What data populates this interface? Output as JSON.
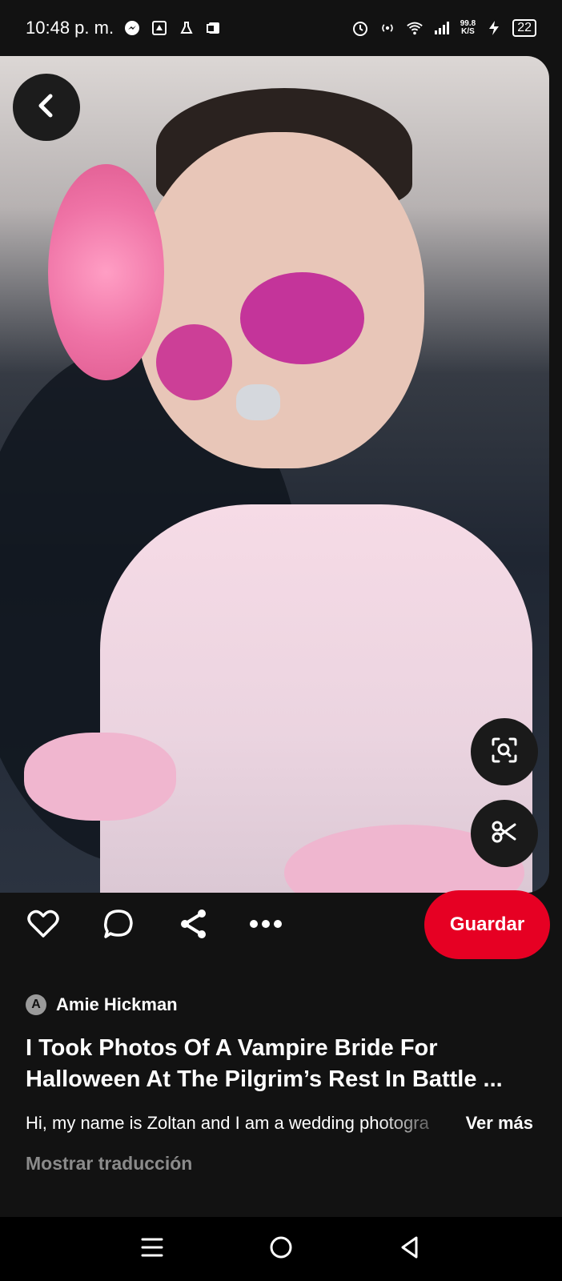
{
  "status_bar": {
    "time": "10:48 p. m.",
    "network_speed_value": "99.8",
    "network_speed_unit": "K/S",
    "battery": "22",
    "icons": [
      "messenger-icon",
      "news-icon",
      "lab-icon",
      "office-icon",
      "alarm-icon",
      "hotspot-icon",
      "wifi-icon",
      "signal-icon",
      "charging-icon",
      "battery-icon"
    ]
  },
  "pin": {
    "image_alt": "Child with sugar-skull face makeup, pink flower and pink dress",
    "author": {
      "initial": "A",
      "name": "Amie Hickman"
    },
    "title": "I Took Photos Of A Vampire Bride For Halloween At The Pilgrim’s Rest In Battle ...",
    "description": "Hi, my name is Zoltan and I am a wedding photogra",
    "see_more": "Ver más",
    "show_translation": "Mostrar traducción"
  },
  "actions": {
    "save_label": "Guardar",
    "icons": [
      "heart-icon",
      "comment-icon",
      "share-icon",
      "more-icon"
    ]
  },
  "image_controls": [
    "back-arrow-icon",
    "visual-search-icon",
    "cutout-scissors-icon"
  ],
  "nav_bar": [
    "menu-icon",
    "home-circle-icon",
    "back-triangle-icon"
  ],
  "colors": {
    "background": "#121212",
    "save_button": "#e60023",
    "translation_text": "#8b8b8b"
  }
}
